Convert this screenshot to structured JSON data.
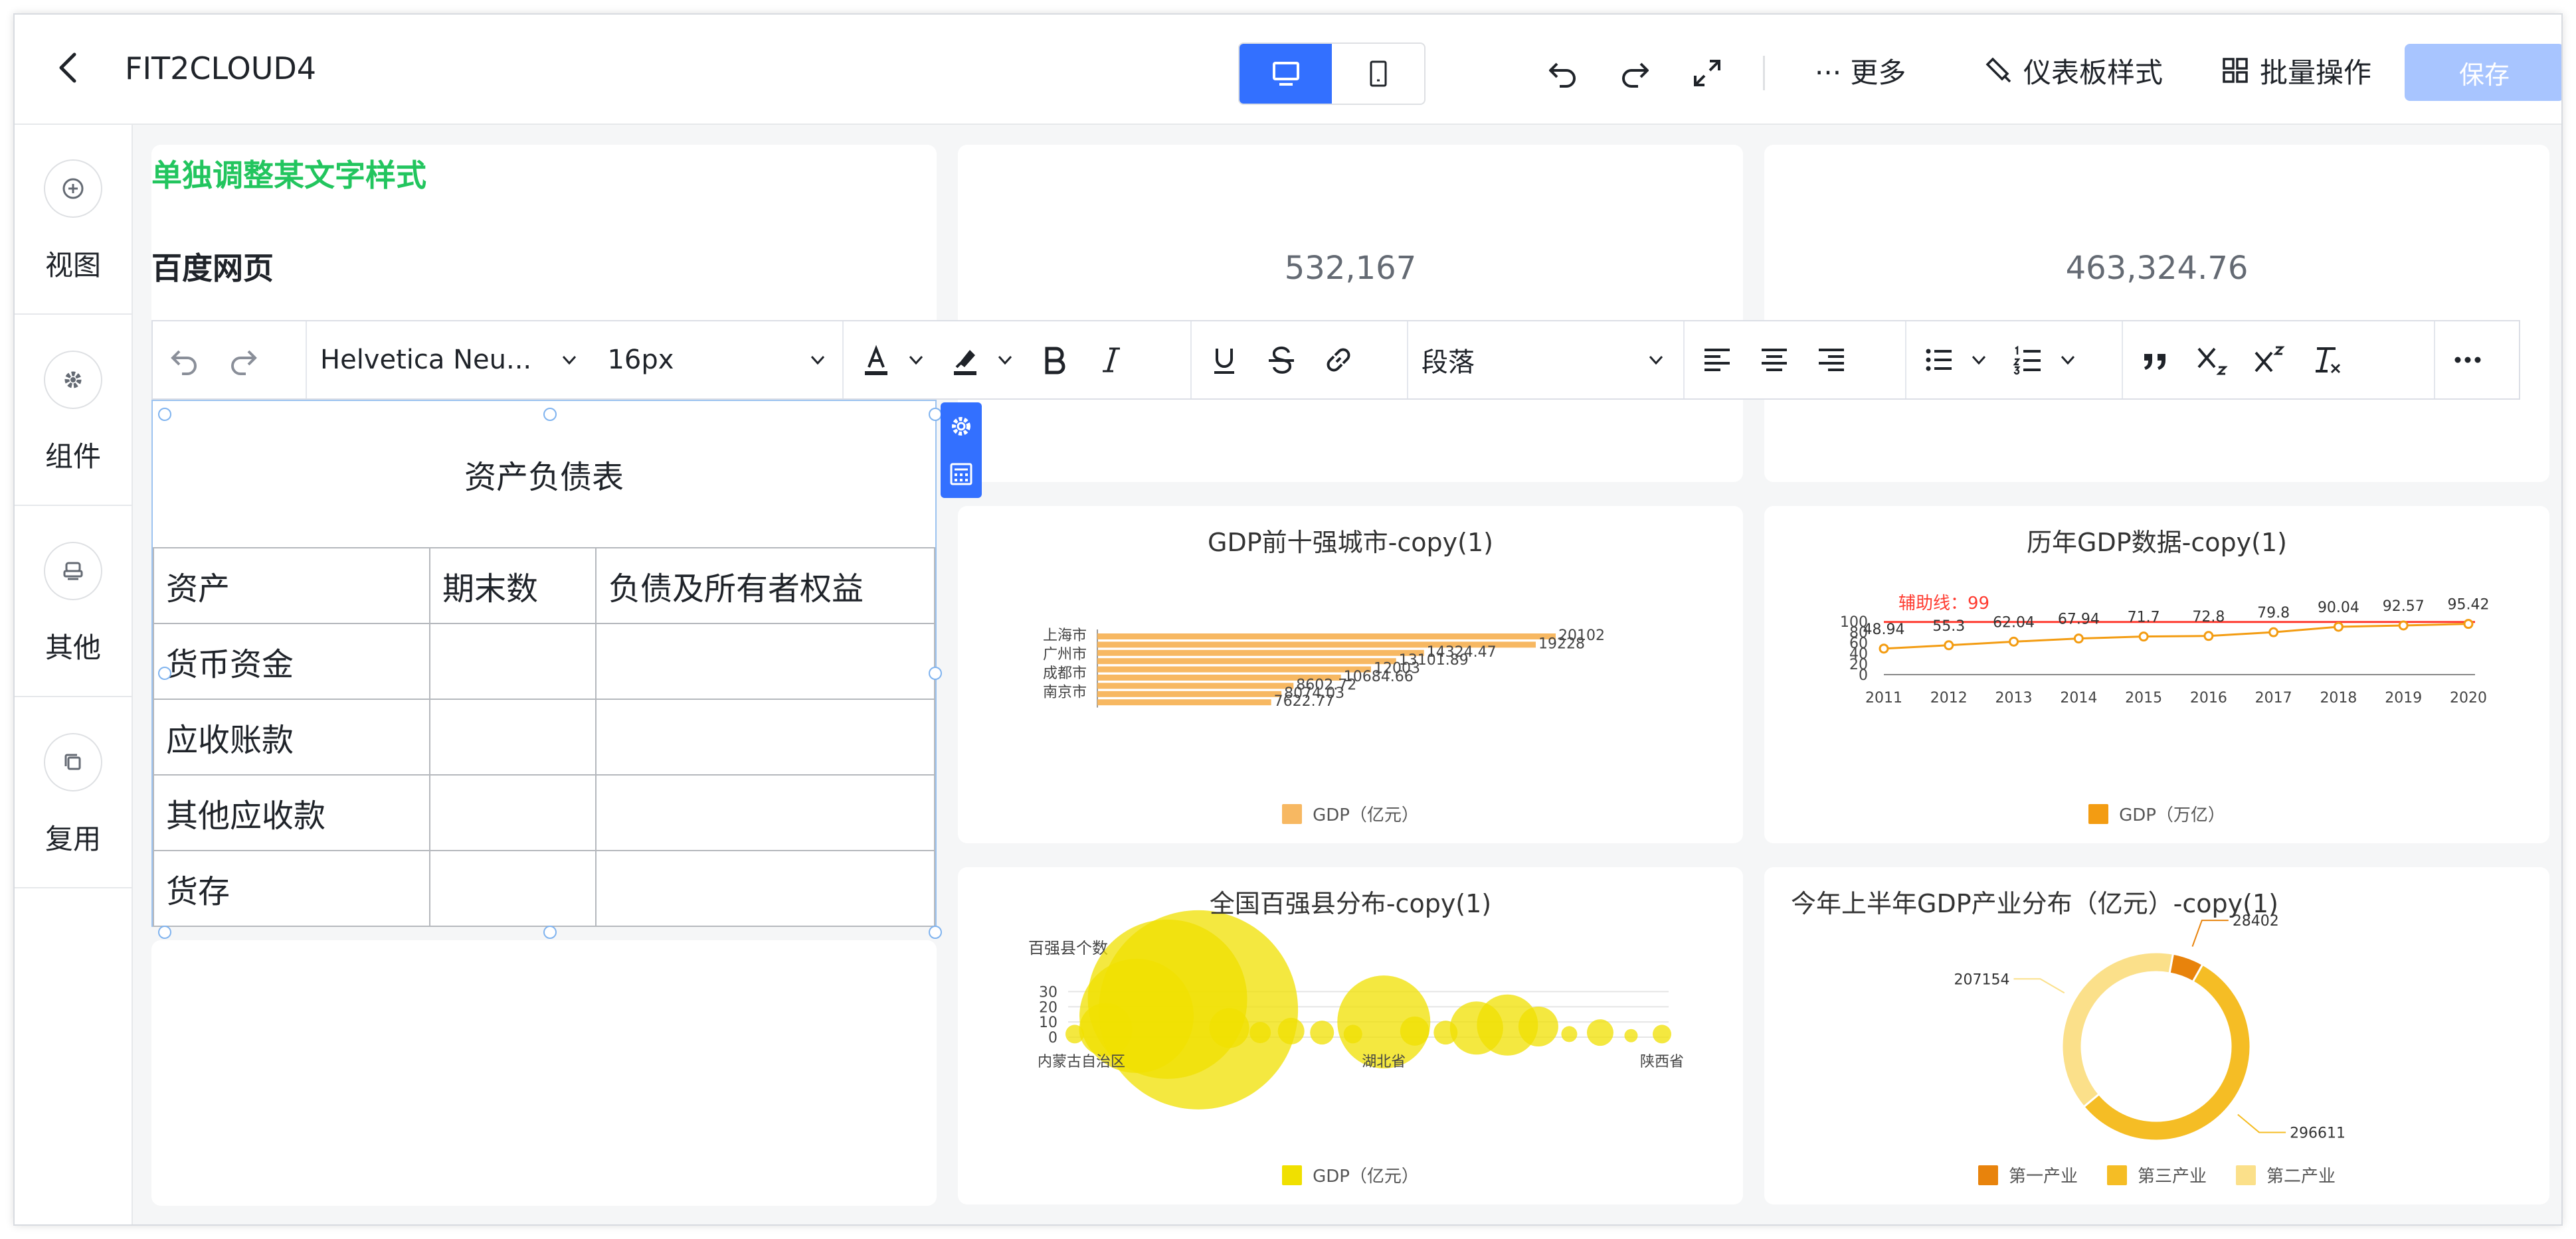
{
  "header": {
    "title": "FIT2CLOUD4",
    "more_label": "··· 更多",
    "dashboard_style_label": "仪表板样式",
    "batch_label": "批量操作",
    "save_label": "保存"
  },
  "sidebar": {
    "items": [
      {
        "label": "视图",
        "icon": "plus-circle-icon"
      },
      {
        "label": "组件",
        "icon": "gear-icon"
      },
      {
        "label": "其他",
        "icon": "stamp-icon"
      },
      {
        "label": "复用",
        "icon": "copy-icon"
      }
    ]
  },
  "rich_text": {
    "green_line": "单独调整某文字样式",
    "bold_line": "百度网页"
  },
  "toolbar": {
    "font_family": "Helvetica Neu...",
    "font_size": "16px",
    "block_format": "段落"
  },
  "table": {
    "title": "资产负债表",
    "rows": [
      [
        "资产",
        "期末数",
        "负债及所有者权益"
      ],
      [
        "货币资金",
        "",
        ""
      ],
      [
        "应收账款",
        "",
        ""
      ],
      [
        "其他应收款",
        "",
        ""
      ],
      [
        "货存",
        "",
        ""
      ]
    ]
  },
  "kpis": [
    {
      "value": "532,167"
    },
    {
      "value": "463,324.76"
    }
  ],
  "chart_data": [
    {
      "type": "bar",
      "orientation": "horizontal",
      "title": "GDP前十强城市-copy(1)",
      "categories": [
        "上海市",
        "",
        "广州市",
        "",
        "成都市",
        "",
        "南京市",
        ""
      ],
      "series": [
        {
          "name": "GDP（亿元）",
          "values": [
            20102,
            19228,
            14324.47,
            13101.89,
            12003,
            10684.66,
            8602.72,
            8074.03,
            7622.77
          ],
          "color": "#f7b862"
        }
      ],
      "value_labels": [
        "20102",
        "19228",
        "14324.47",
        "13101.89",
        "12003",
        "10684.66",
        "8602.72",
        "8074.03",
        "7622.77"
      ],
      "legend": "bottom"
    },
    {
      "type": "line",
      "title": "历年GDP数据-copy(1)",
      "x": [
        "2011",
        "2012",
        "2013",
        "2014",
        "2015",
        "2016",
        "2017",
        "2018",
        "2019",
        "2020"
      ],
      "series": [
        {
          "name": "GDP（万亿）",
          "values": [
            48.94,
            55.3,
            62.04,
            67.94,
            71.7,
            72.8,
            79.8,
            90.04,
            92.57,
            95.42
          ],
          "color": "#f39c12"
        }
      ],
      "y_ticks": [
        "0",
        "20",
        "40",
        "60",
        "80",
        "100"
      ],
      "ylim": [
        0,
        100
      ],
      "reference_line": {
        "label": "辅助线：99",
        "value": 99,
        "color": "#ff3b30"
      },
      "legend": "bottom"
    },
    {
      "type": "scatter",
      "title": "全国百强县分布-copy(1)",
      "ylabel": "百强县个数",
      "y_ticks": [
        "0",
        "10",
        "20",
        "30"
      ],
      "ylim": [
        0,
        35
      ],
      "x_labels": [
        "内蒙古自治区",
        "",
        "",
        "",
        "",
        "",
        "",
        "",
        "",
        "",
        "湖北省",
        "",
        "",
        "",
        "",
        "",
        "",
        "",
        "",
        "陕西省"
      ],
      "series": [
        {
          "name": "GDP（亿元）",
          "color": "#f0e000",
          "values": [
            2,
            5,
            14,
            25,
            18,
            6,
            3,
            4,
            3,
            2,
            10,
            4,
            3,
            6,
            8,
            7,
            2,
            3,
            1,
            2
          ],
          "sizes": [
            14,
            40,
            86,
            120,
            150,
            30,
            16,
            20,
            18,
            14,
            70,
            22,
            18,
            40,
            46,
            30,
            12,
            20,
            10,
            14
          ]
        }
      ],
      "legend": "bottom"
    },
    {
      "type": "pie",
      "donut": true,
      "title": "今年上半年GDP产业分布（亿元）-copy(1)",
      "series": [
        {
          "name": "第一产业",
          "value": 28402,
          "color": "#e8830c"
        },
        {
          "name": "第三产业",
          "value": 296611,
          "color": "#f5bd25"
        },
        {
          "name": "第二产业",
          "value": 207154,
          "color": "#fbe08a"
        }
      ],
      "legend": "bottom"
    }
  ]
}
